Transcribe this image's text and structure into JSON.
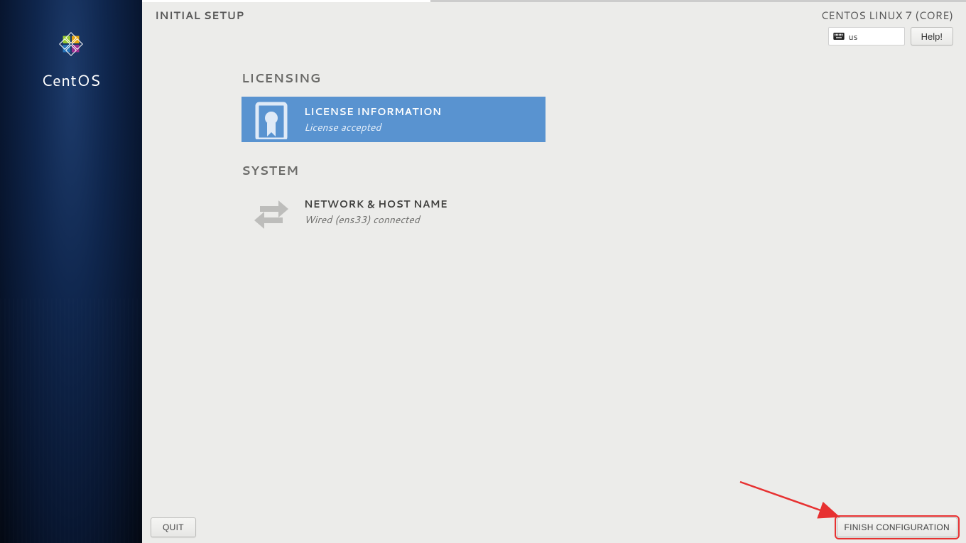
{
  "header": {
    "title": "INITIAL SETUP",
    "distro": "CENTOS LINUX 7 (CORE)",
    "keyboard_layout": "us",
    "help_label": "Help!"
  },
  "brand": {
    "name": "CentOS"
  },
  "sections": {
    "licensing": {
      "label": "LICENSING",
      "spoke_title": "LICENSE INFORMATION",
      "spoke_status": "License accepted"
    },
    "system": {
      "label": "SYSTEM",
      "spoke_title": "NETWORK & HOST NAME",
      "spoke_status": "Wired (ens33) connected"
    }
  },
  "footer": {
    "quit_label": "QUIT",
    "finish_label": "FINISH CONFIGURATION"
  }
}
